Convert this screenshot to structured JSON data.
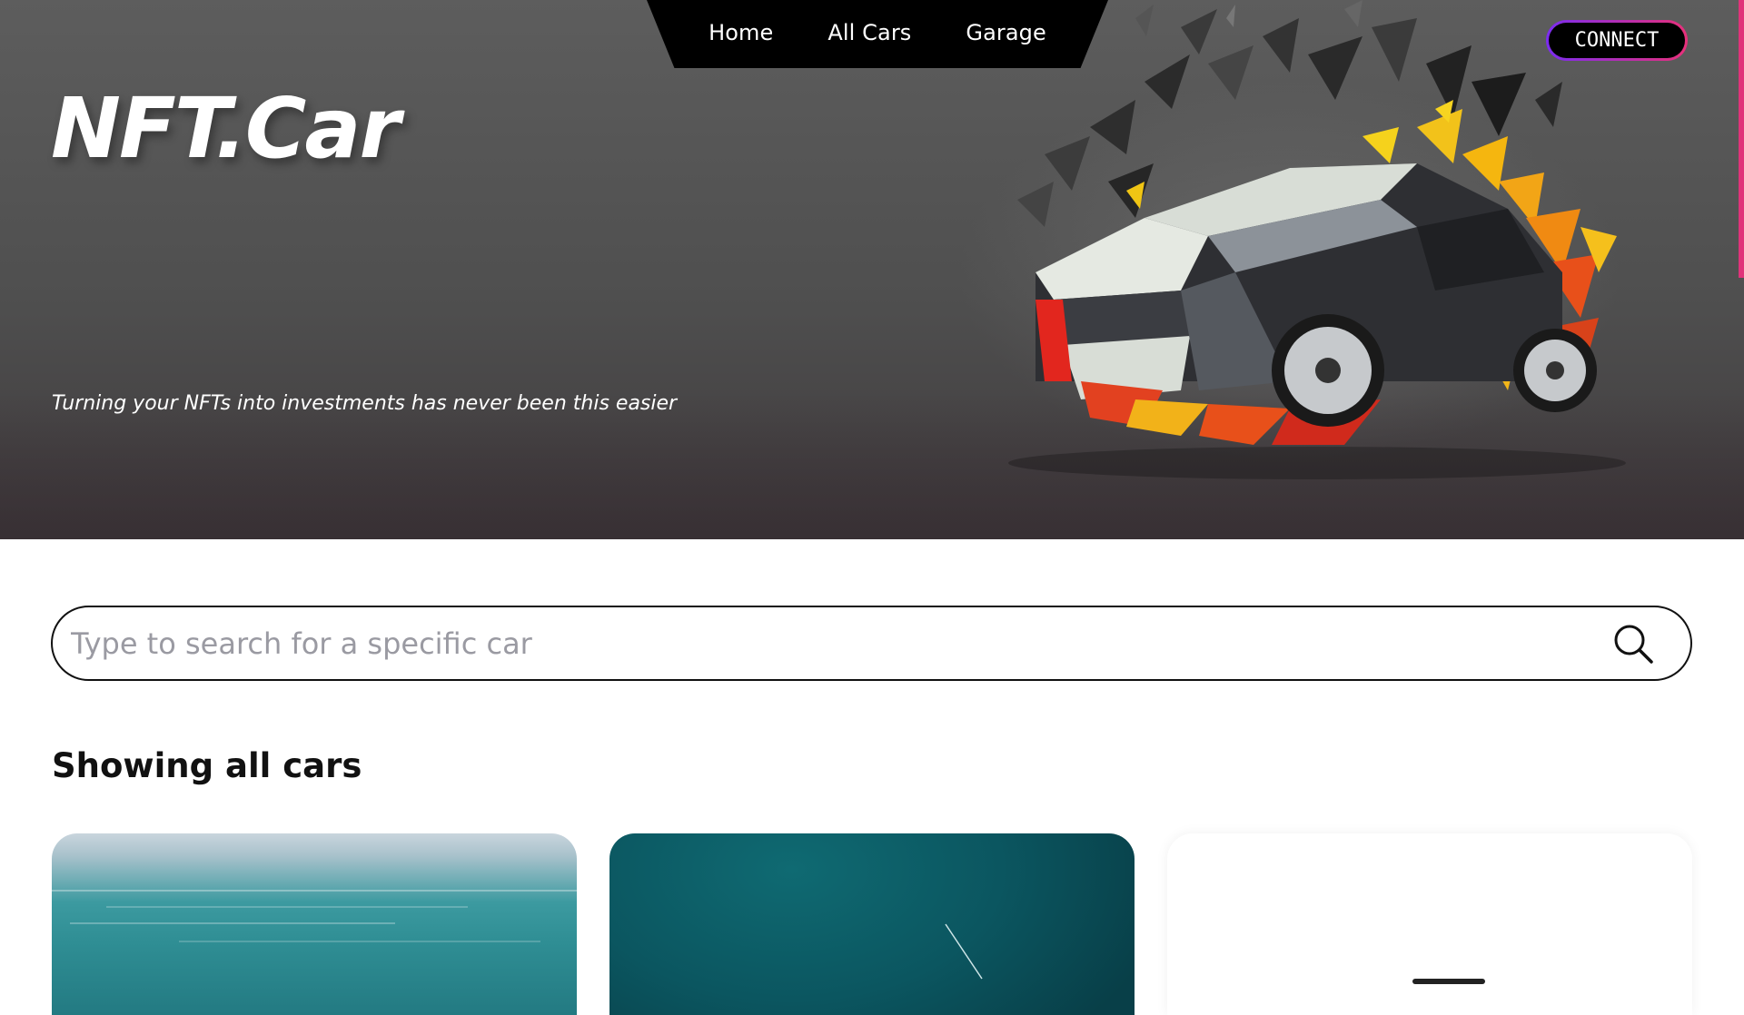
{
  "nav": {
    "links": [
      {
        "label": "Home"
      },
      {
        "label": "All Cars"
      },
      {
        "label": "Garage"
      }
    ]
  },
  "header": {
    "connect_label": "CONNECT"
  },
  "hero": {
    "brand": "NFT.Car",
    "tagline": "Turning your NFTs into investments has never been this easier"
  },
  "search": {
    "placeholder": "Type to search for a specific car",
    "value": "",
    "icon": "search-icon"
  },
  "results": {
    "title": "Showing all cars",
    "cards": [
      {
        "image": "ocean-waves"
      },
      {
        "image": "teal-gradient"
      },
      {
        "image": "white-car"
      }
    ]
  },
  "colors": {
    "nav_bg": "#000000",
    "connect_gradient_start": "#7b2cf0",
    "connect_gradient_end": "#e8307a",
    "scroll_accent": "#e0337a"
  }
}
